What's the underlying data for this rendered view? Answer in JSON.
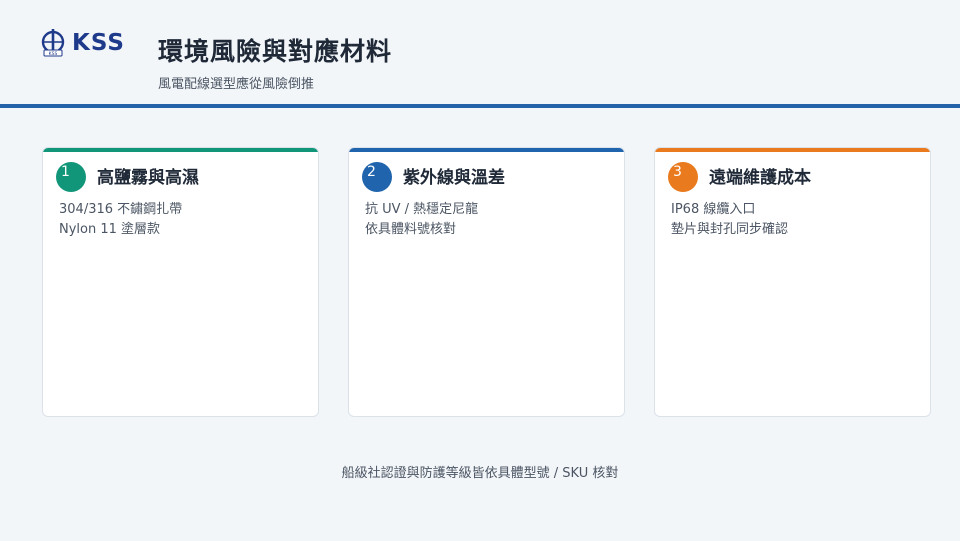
{
  "header": {
    "logo_text": "KSS",
    "title": "環境風險與對應材料",
    "subtitle": "風電配線選型應從風險倒推"
  },
  "cards": [
    {
      "number": "1",
      "title": "高鹽霧與高濕",
      "color": "#11967a",
      "lines": [
        "304/316 不鏽鋼扎帶",
        "Nylon 11 塗層款"
      ]
    },
    {
      "number": "2",
      "title": "紫外線與溫差",
      "color": "#1f64ad",
      "lines": [
        "抗 UV / 熱穩定尼龍",
        "依具體料號核對"
      ]
    },
    {
      "number": "3",
      "title": "遠端維護成本",
      "color": "#ea7a1e",
      "lines": [
        "IP68 線纜入口",
        "墊片與封孔同步確認"
      ]
    }
  ],
  "footer": {
    "note": "船級社認證與防護等級皆依具體型號 / SKU 核對"
  },
  "colors": {
    "rule": "#2563a8",
    "background": "#f3f6f9"
  }
}
